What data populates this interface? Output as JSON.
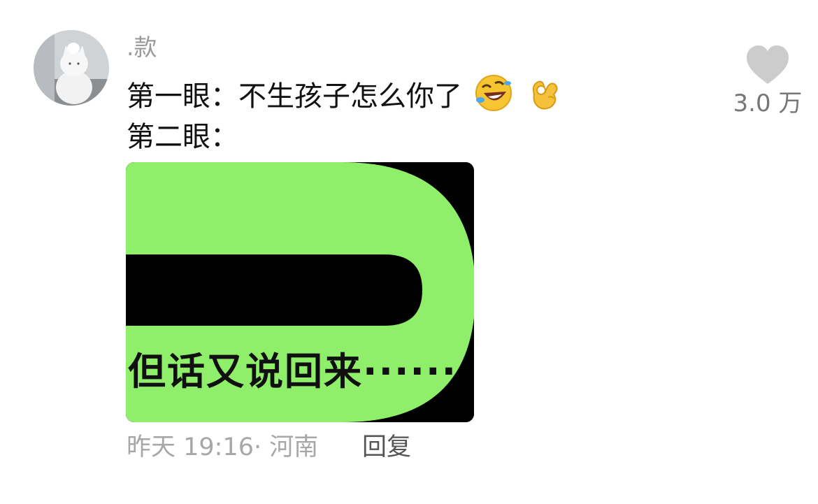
{
  "comment": {
    "username": ".款",
    "line1_text": "第一眼：不生孩子怎么你了",
    "line1_emojis": [
      "rolling-laughing-emoji",
      "ok-hand-emoji"
    ],
    "line2_text": "第二眼：",
    "image": {
      "caption": "但话又说回来······",
      "colors": {
        "green": "#90ef6a",
        "black": "#000000"
      }
    },
    "timestamp": "昨天 19:16· 河南",
    "reply_label": "回复"
  },
  "like": {
    "icon": "heart-icon",
    "count": "3.0 万",
    "color": "#cccccc"
  }
}
